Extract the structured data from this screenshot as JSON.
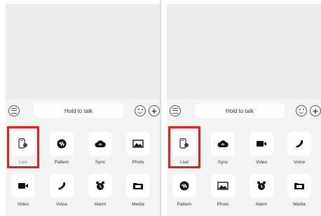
{
  "colors": {
    "highlight": "#e02020",
    "tile_bg": "#ffffff",
    "panel_bg": "#f4f4f4",
    "chat_bg": "#ececec"
  },
  "panels": [
    {
      "input_bar": {
        "hold_to_talk": "Hold to talk",
        "voice_icon": "voice-toggle-icon",
        "emoji_icon": "emoji-icon",
        "plus_icon": "plus-icon"
      },
      "features": [
        {
          "label": "Live",
          "icon": "live-phone-icon",
          "highlighted": true
        },
        {
          "label": "Pattern",
          "icon": "pattern-icon"
        },
        {
          "label": "Sync",
          "icon": "sync-cloud-icon"
        },
        {
          "label": "Photo",
          "icon": "photo-icon"
        },
        {
          "label": "Video",
          "icon": "video-camera-icon"
        },
        {
          "label": "Voice",
          "icon": "voice-call-icon"
        },
        {
          "label": "Alarm",
          "icon": "alarm-clock-icon"
        },
        {
          "label": "Media",
          "icon": "media-folder-icon"
        }
      ]
    },
    {
      "input_bar": {
        "hold_to_talk": "Hold to talk",
        "voice_icon": "voice-toggle-icon",
        "emoji_icon": "emoji-icon",
        "plus_icon": "plus-icon"
      },
      "features": [
        {
          "label": "Live",
          "icon": "live-phone-icon",
          "highlighted": true
        },
        {
          "label": "Sync",
          "icon": "sync-cloud-icon"
        },
        {
          "label": "Video",
          "icon": "video-camera-icon"
        },
        {
          "label": "Voice",
          "icon": "voice-call-icon"
        },
        {
          "label": "Pattern",
          "icon": "pattern-icon"
        },
        {
          "label": "Photo",
          "icon": "photo-icon"
        },
        {
          "label": "Alarm",
          "icon": "alarm-clock-icon"
        },
        {
          "label": "Media",
          "icon": "media-folder-icon"
        }
      ]
    }
  ]
}
